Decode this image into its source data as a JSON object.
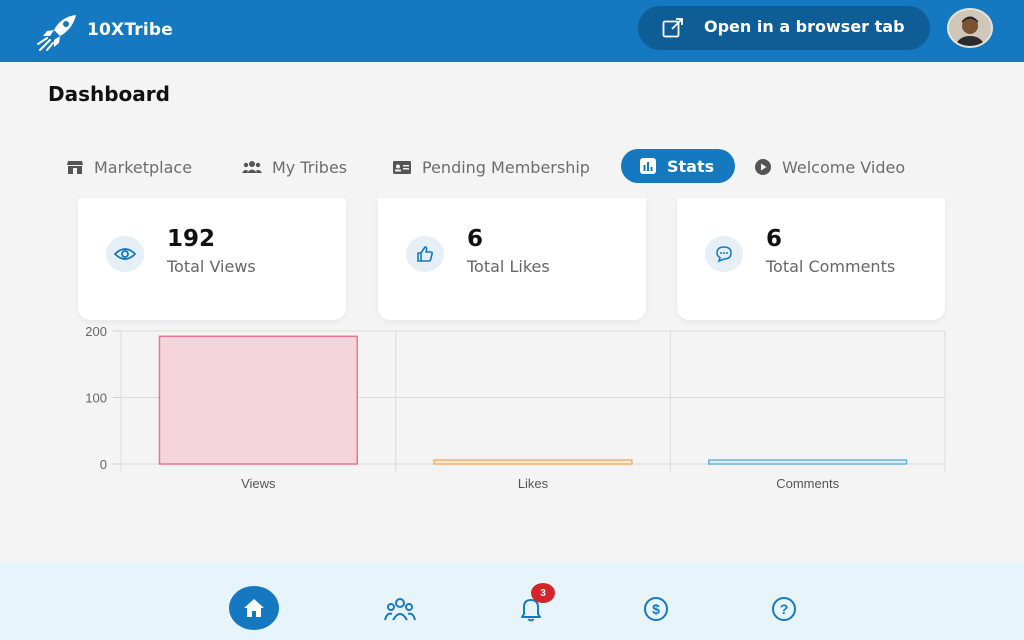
{
  "app": {
    "brand": "10XTribe"
  },
  "header": {
    "open_tab_label": "Open in a browser tab"
  },
  "page": {
    "title": "Dashboard"
  },
  "tabs": [
    {
      "label": "Marketplace",
      "icon": "store-icon",
      "active": false
    },
    {
      "label": "My Tribes",
      "icon": "people-icon",
      "active": false
    },
    {
      "label": "Pending Membership",
      "icon": "id-card-icon",
      "active": false
    },
    {
      "label": "Stats",
      "icon": "bar-chart-icon",
      "active": true
    },
    {
      "label": "Welcome Video",
      "icon": "play-icon",
      "active": false
    }
  ],
  "stats": [
    {
      "value": "192",
      "label": "Total Views",
      "icon": "eye-icon"
    },
    {
      "value": "6",
      "label": "Total Likes",
      "icon": "thumbs-up-icon"
    },
    {
      "value": "6",
      "label": "Total Comments",
      "icon": "comment-icon"
    }
  ],
  "chart_data": {
    "type": "bar",
    "categories": [
      "Views",
      "Likes",
      "Comments"
    ],
    "values": [
      192,
      6,
      6
    ],
    "colors": [
      "#f4d5dc",
      "#fbe9d2",
      "#dcecf7"
    ],
    "borders": [
      "#e8758f",
      "#f0b070",
      "#6fb2e0"
    ],
    "yticks": [
      "0",
      "100",
      "200"
    ],
    "ylim": [
      0,
      200
    ],
    "grid": true
  },
  "bottom_nav": {
    "items": [
      "home-icon",
      "community-icon",
      "bell-icon",
      "dollar-icon",
      "help-icon"
    ],
    "notification_count": "3"
  },
  "colors": {
    "primary": "#1479c1",
    "badge": "#d4252a"
  }
}
